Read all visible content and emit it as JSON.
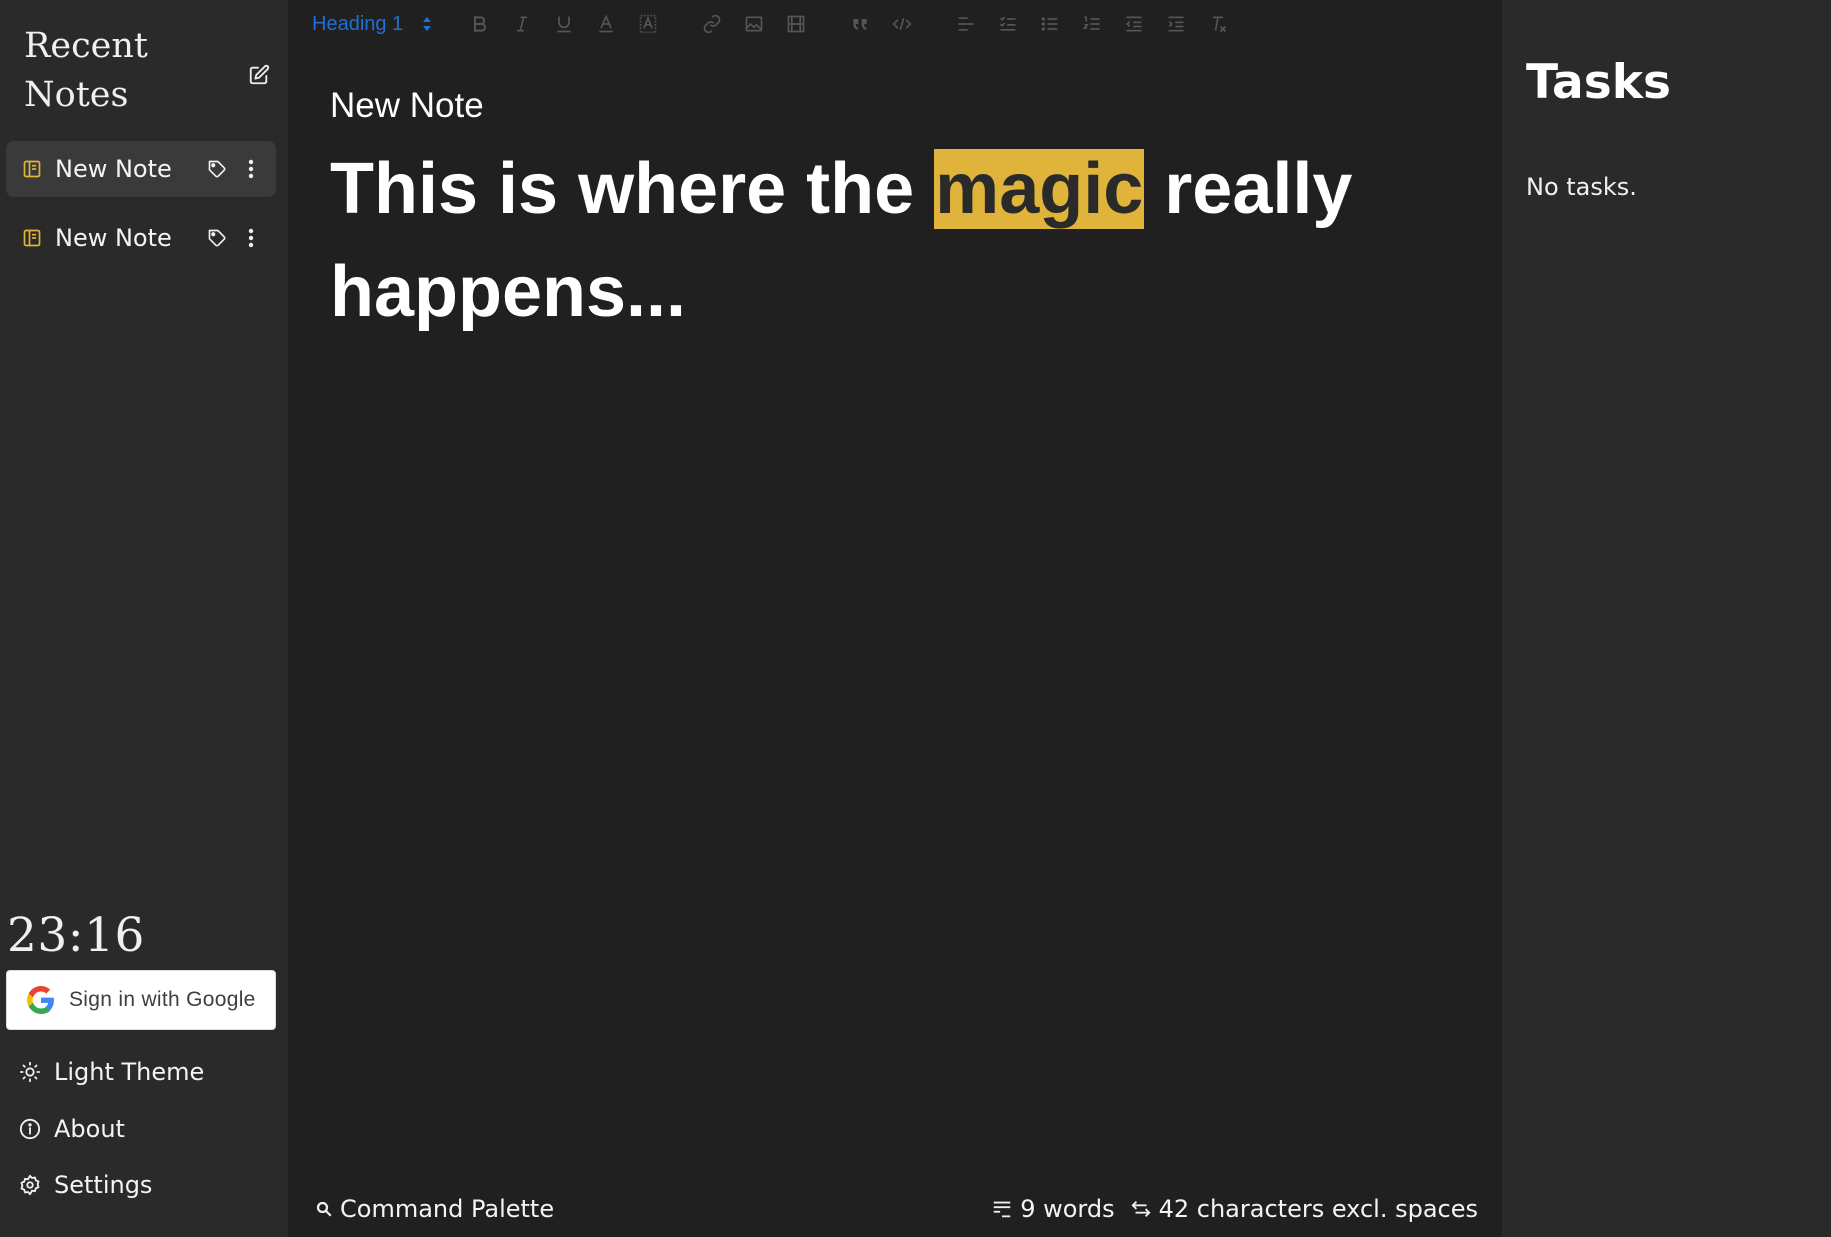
{
  "sidebar": {
    "title": "Recent Notes",
    "compose_icon": "edit-icon",
    "notes": [
      {
        "label": "New Note",
        "icon": "note-icon",
        "active": true
      },
      {
        "label": "New Note",
        "icon": "note-icon",
        "active": false
      }
    ],
    "clock": "23:16",
    "google_signin_label": "Sign in with Google",
    "links": [
      {
        "label": "Light Theme",
        "icon": "sun-icon"
      },
      {
        "label": "About",
        "icon": "info-icon"
      },
      {
        "label": "Settings",
        "icon": "gear-icon"
      }
    ]
  },
  "editor": {
    "toolbar": {
      "heading_select": "Heading 1",
      "buttons": [
        "bold-icon",
        "italic-icon",
        "underline-icon",
        "text-color-icon",
        "highlight-icon",
        "link-icon",
        "image-icon",
        "video-icon",
        "quote-icon",
        "code-icon",
        "align-icon",
        "checklist-icon",
        "bullet-list-icon",
        "numbered-list-icon",
        "outdent-icon",
        "indent-icon",
        "clear-format-icon"
      ]
    },
    "note_title": "New Note",
    "body_before": "This is where the ",
    "body_highlight": "magic",
    "body_after": " really happens...",
    "status": {
      "command_palette": "Command Palette",
      "words": "9 words",
      "characters": "42 characters excl. spaces"
    }
  },
  "tasks": {
    "title": "Tasks",
    "empty_text": "No tasks."
  },
  "colors": {
    "accent_yellow": "#e0b43a",
    "link_blue": "#1e6fd9",
    "sidebar_bg": "#2a2a2a",
    "editor_bg": "#202020"
  }
}
